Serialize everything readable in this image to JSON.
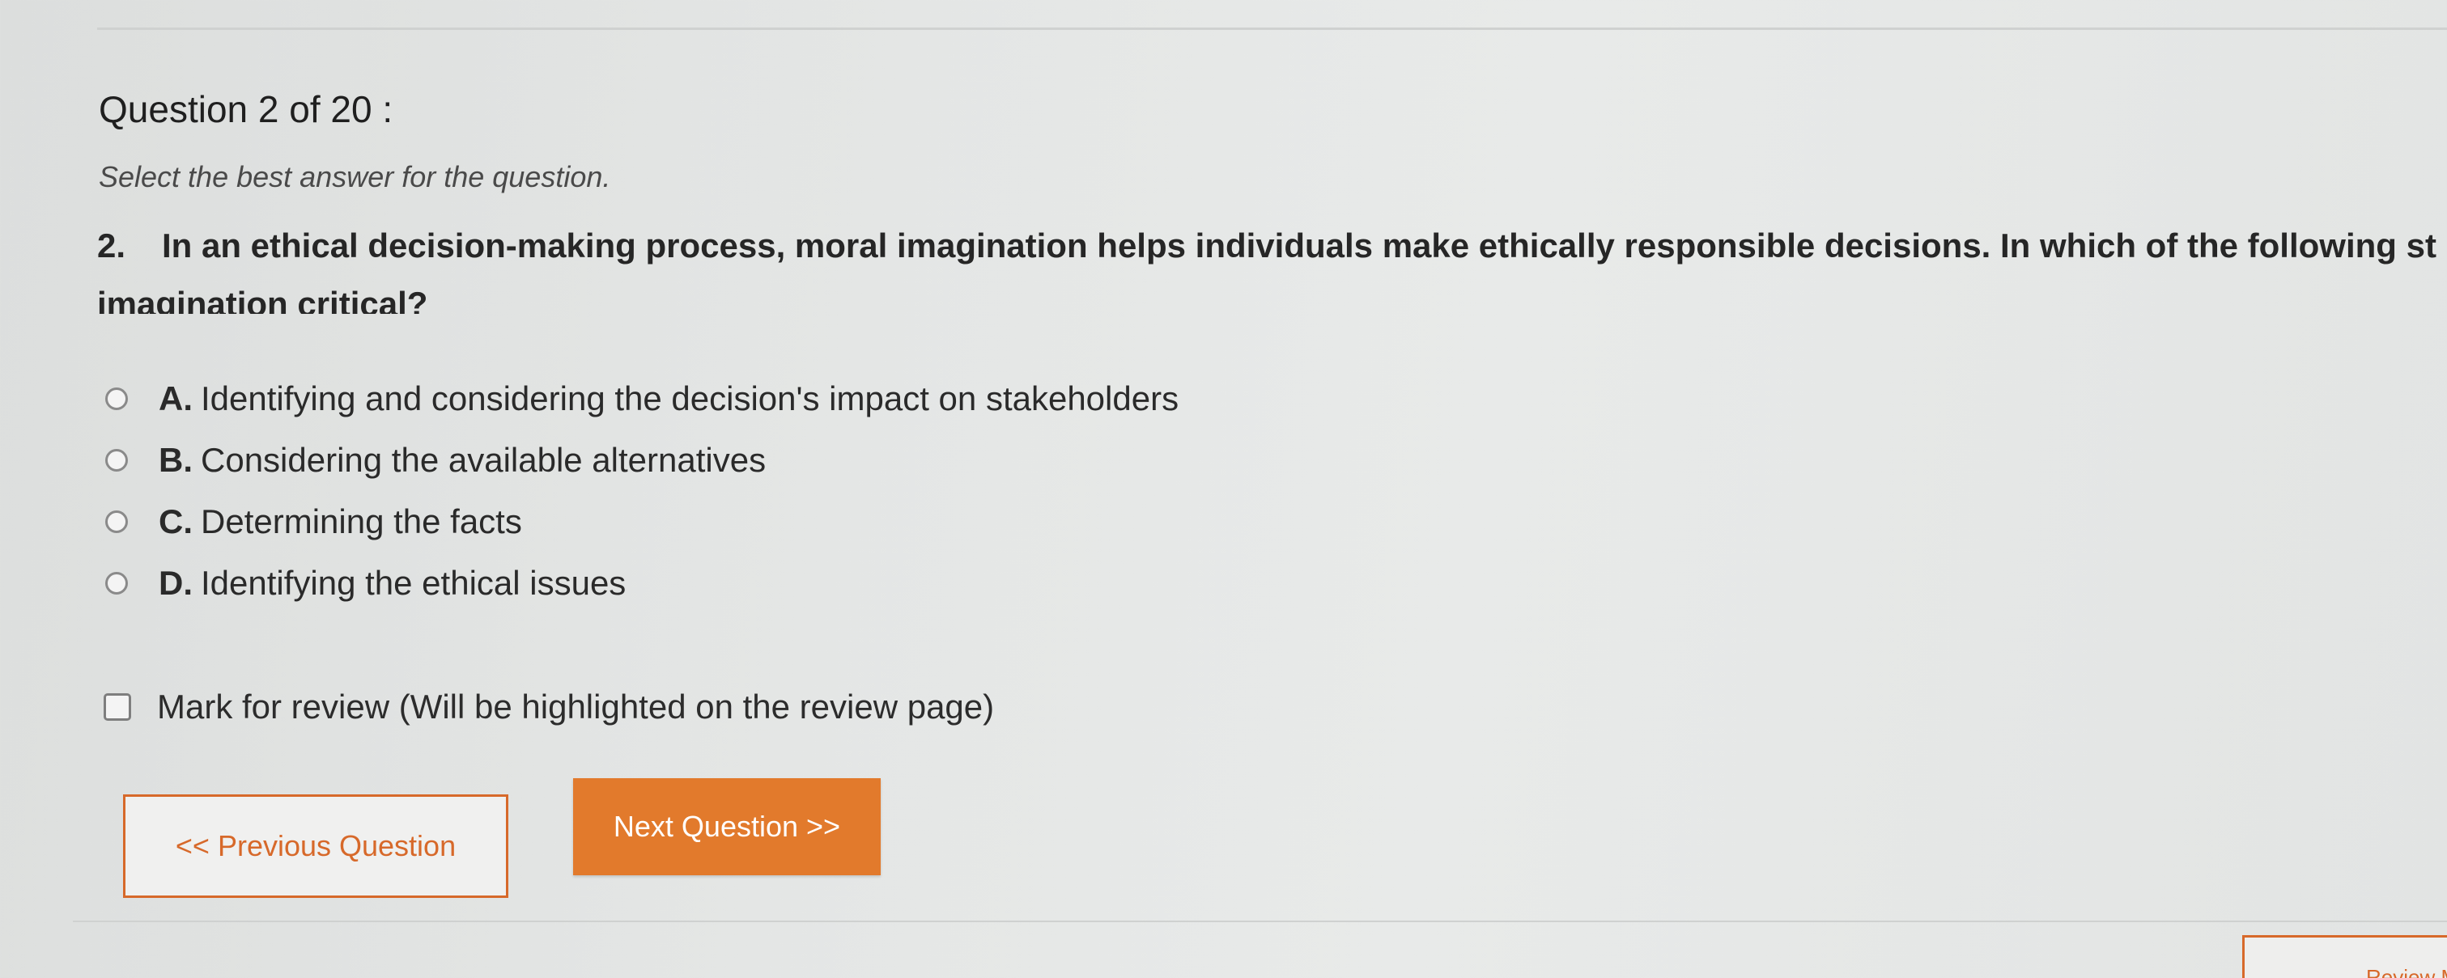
{
  "quiz": {
    "header": "Question 2 of 20 :",
    "instruction": "Select the best answer for the question.",
    "question_number": "2.",
    "question_line1": "In an ethical decision-making process, moral imagination helps individuals make ethically responsible decisions. In which of the following st",
    "question_line2": "imagination critical?",
    "options": [
      {
        "letter": "A.",
        "text": "Identifying and considering the decision's impact on stakeholders"
      },
      {
        "letter": "B.",
        "text": "Considering the available alternatives"
      },
      {
        "letter": "C.",
        "text": "Determining the facts"
      },
      {
        "letter": "D.",
        "text": "Identifying the ethical issues"
      }
    ],
    "mark_review_label": "Mark for review (Will be highlighted on the review page)"
  },
  "nav": {
    "previous_label": "<< Previous Question",
    "next_label": "Next Question >>",
    "corner_label": "Review My A"
  },
  "colors": {
    "accent": "#e27a2c",
    "accent_border": "#d7692a",
    "background": "#e4e6e5"
  }
}
